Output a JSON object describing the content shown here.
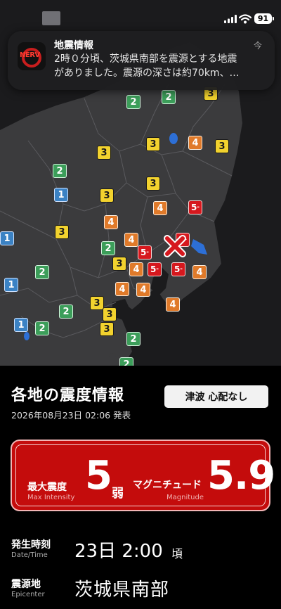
{
  "status_bar": {
    "battery": "91"
  },
  "notification": {
    "app_icon_text": "NERV",
    "title": "地震情報",
    "time": "今",
    "body_line1": "2時０分頃、茨城県南部を震源とする地震",
    "body_line2": "がありました。震源の深さは約70km、…"
  },
  "map": {
    "labels": {
      "int1": "1",
      "int2": "2",
      "int3": "3",
      "int4": "4",
      "int5": "5",
      "int5_sub": "-"
    }
  },
  "panel": {
    "title": "各地の震度情報",
    "issued": "2026年08月23日 02:06 発表",
    "tsunami": "津波 心配なし",
    "max_intensity_label": "最大震度",
    "max_intensity_label_en": "Max Intensity",
    "max_intensity_value": "5",
    "max_intensity_suffix": "弱",
    "magnitude_label": "マグニチュード",
    "magnitude_label_en": "Magnitude",
    "magnitude_value": "5.9",
    "time_label": "発生時刻",
    "time_label_en": "Date/Time",
    "time_value": "23日 2:00",
    "time_suffix": "頃",
    "epicenter_label": "震源地",
    "epicenter_label_en": "Epicenter",
    "epicenter_value": "茨城県南部"
  },
  "colors": {
    "intensity_1": "#3b82c4",
    "intensity_2": "#3c9e5a",
    "intensity_3": "#f2d22e",
    "intensity_4": "#e07a2a",
    "intensity_5_lower": "#d6181e",
    "max_box": "#c40c0c"
  },
  "icons": [
    "signal-icon",
    "wifi-icon",
    "battery-icon",
    "nerv-app-icon",
    "epicenter-x-icon"
  ]
}
